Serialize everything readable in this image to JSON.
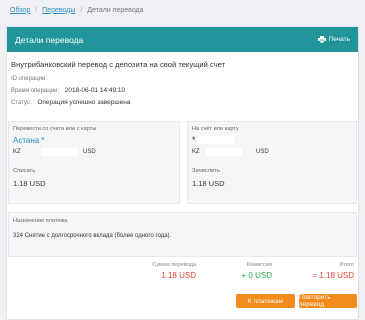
{
  "breadcrumb": {
    "items": [
      "Обзор",
      "Переводы",
      "Детали перевода"
    ]
  },
  "header": {
    "title": "Детали перевода",
    "print_label": "Печать"
  },
  "operation": {
    "title": "Внутрибанковский перевод с депозита на свой текущий счет",
    "id_label": "ID операции:",
    "id_value": "",
    "time_label": "Время операции:",
    "time_value": "2018-06-01 14:49:10",
    "status_label": "Статус:",
    "status_value": "Операция успешно завершена"
  },
  "from_card": {
    "label": "Перевести со счета или с карты",
    "bank": "Астана",
    "marker": "*",
    "country": "KZ",
    "currency": "USD",
    "amount_label": "Списать",
    "amount": "1.18 USD"
  },
  "to_card": {
    "label": "На счёт или карту",
    "marker": "*",
    "country": "KZ",
    "currency": "USD",
    "amount_label": "Зачислить",
    "amount": "1.18 USD"
  },
  "purpose": {
    "label": "Назначение платежа",
    "text": "324  Снятие с долгосрочного вклада (более одного года)."
  },
  "summary": {
    "sum_label": "Сумма перевода",
    "sum_value": "1.18 USD",
    "fee_label": "Комиссия",
    "fee_value": "+ 0 USD",
    "total_label": "Итого",
    "total_value": "= 1.18 USD"
  },
  "actions": {
    "to_payments": "К платежам",
    "repeat": "Повторить перевод"
  },
  "colors": {
    "header": "#22959a",
    "accent": "#f28a1c",
    "link": "#2a8fbd",
    "red": "#e0463a",
    "green": "#2aa64f"
  }
}
